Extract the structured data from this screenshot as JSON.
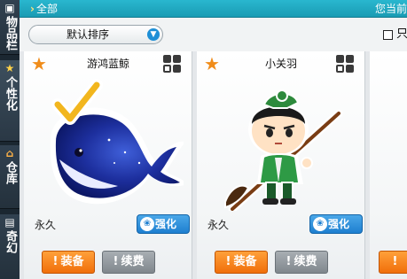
{
  "sidebar": {
    "tabs": [
      {
        "label": "物品栏",
        "icon": "box-icon"
      },
      {
        "label": "个性化",
        "icon": "star-icon"
      },
      {
        "label": "仓库",
        "icon": "home-icon"
      },
      {
        "label": "奇幻",
        "icon": "scroll-icon"
      }
    ]
  },
  "topbar": {
    "crumb": "全部",
    "status": "您当前"
  },
  "sortbar": {
    "sort_label": "默认排序",
    "checkbox_label": "只"
  },
  "items": [
    {
      "name": "游鸿蓝鲸",
      "duration": "永久",
      "enhance_label": "强化",
      "equip_label": "装备",
      "renew_label": "续费",
      "equipped": true
    },
    {
      "name": "小关羽",
      "duration": "永久",
      "enhance_label": "强化",
      "equip_label": "装备",
      "renew_label": "续费",
      "equipped": false
    },
    {
      "name": "",
      "duration": "",
      "enhance_label": "",
      "equip_label": "",
      "renew_label": "",
      "equipped": false
    }
  ],
  "colors": {
    "topbar": "#1a9bb3",
    "equip_button": "#f06f0a",
    "renew_button": "#80878d",
    "enhance_badge": "#1e7fd0",
    "favorite_star": "#f08c1a"
  }
}
